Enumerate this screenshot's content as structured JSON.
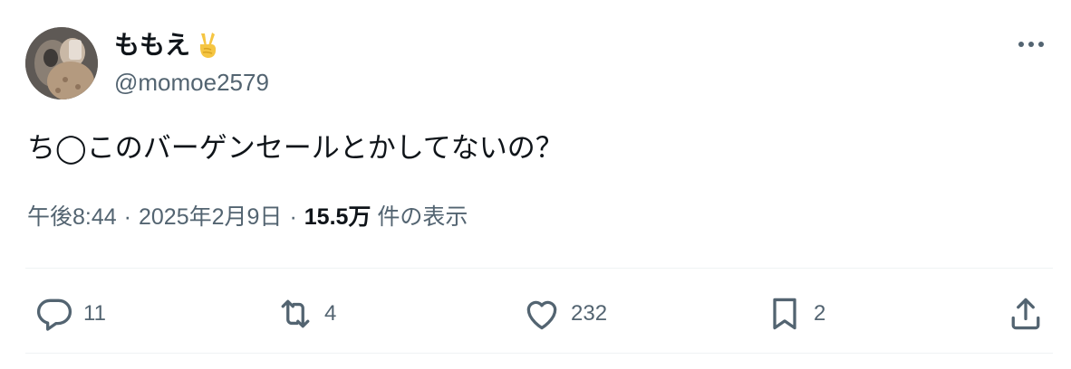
{
  "user": {
    "display_name": "ももえ",
    "name_emoji": "victory-hand-emoji",
    "handle": "@momoe2579"
  },
  "tweet": {
    "text": "ち◯このバーゲンセールとかしてないの？"
  },
  "meta": {
    "time": "午後8:44",
    "separator": "·",
    "date": "2025年2月9日",
    "views_count": "15.5万",
    "views_label": "件の表示"
  },
  "actions": {
    "reply_count": "11",
    "retweet_count": "4",
    "like_count": "232",
    "bookmark_count": "2"
  },
  "colors": {
    "text_primary": "#0f1419",
    "text_secondary": "#536471",
    "divider": "#eff3f4"
  },
  "icons": {
    "more": "more-horizontal-icon",
    "reply": "reply-icon",
    "retweet": "retweet-icon",
    "like": "heart-icon",
    "bookmark": "bookmark-icon",
    "share": "share-icon"
  }
}
